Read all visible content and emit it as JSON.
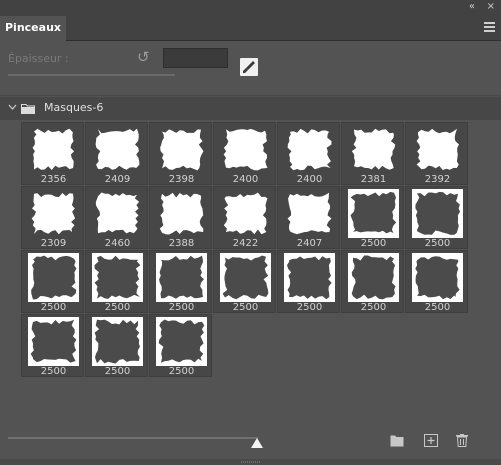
{
  "window": {
    "collapse_glyph": "«",
    "close_glyph": "×"
  },
  "panel": {
    "tab_title": "Pinceaux"
  },
  "thickness": {
    "label": "Épaisseur :"
  },
  "group": {
    "name": "Masques-6",
    "icon": "folder-icon"
  },
  "brushes": [
    "2356",
    "2409",
    "2398",
    "2400",
    "2400",
    "2381",
    "2392",
    "2309",
    "2460",
    "2388",
    "2422",
    "2407",
    "2500",
    "2500",
    "2500",
    "2500",
    "2500",
    "2500",
    "2500",
    "2500",
    "2500",
    "2500",
    "2500",
    "2500"
  ],
  "brush_style": {
    "white_tip_count": 12,
    "white_color": "#ffffff",
    "dark_color": "#4b4b4b"
  },
  "colors": {
    "panel_bg": "#535353",
    "header_bg": "#424242",
    "group_bg": "#474747"
  },
  "bottom_icons": [
    "new-group-icon",
    "new-brush-icon",
    "trash-icon"
  ]
}
